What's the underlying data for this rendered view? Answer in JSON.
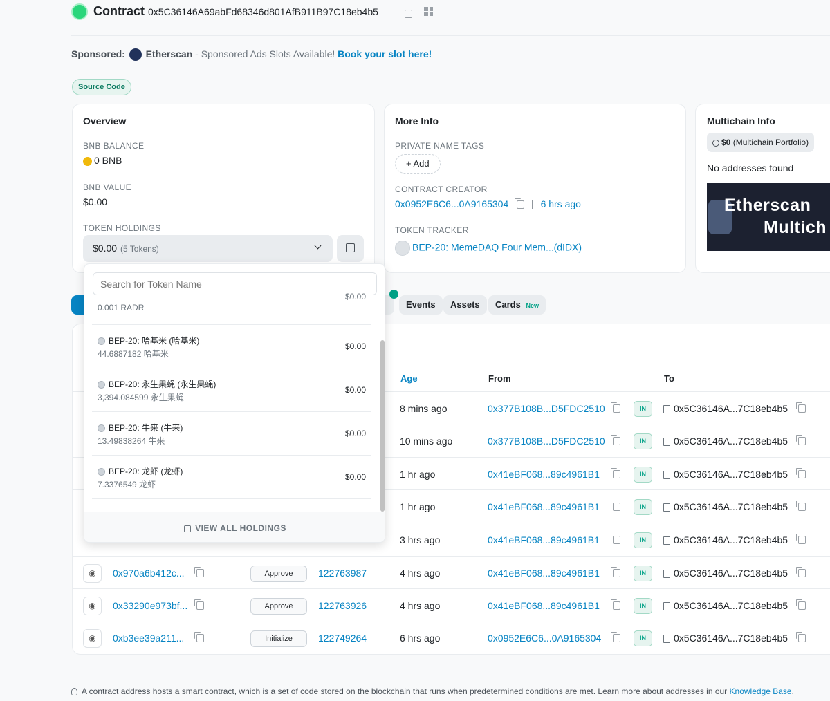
{
  "header": {
    "title": "Contract",
    "address": "0x5C36146A69abFd68346d801AfB911B97C18eb4b5"
  },
  "sponsored": {
    "label": "Sponsored:",
    "brand": "Etherscan",
    "text": " - Sponsored Ads Slots Available! ",
    "cta": "Book your slot here!"
  },
  "source_code_badge": "Source Code",
  "overview": {
    "title": "Overview",
    "bnb_balance_label": "BNB BALANCE",
    "bnb_balance": "0 BNB",
    "bnb_value_label": "BNB VALUE",
    "bnb_value": "$0.00",
    "token_holdings_label": "TOKEN HOLDINGS",
    "token_holdings_value": "$0.00",
    "token_holdings_count": "(5 Tokens)"
  },
  "more_info": {
    "title": "More Info",
    "private_tags_label": "PRIVATE NAME TAGS",
    "add_label": "+ Add",
    "creator_label": "CONTRACT CREATOR",
    "creator_address": "0x0952E6C6...0A9165304",
    "creator_sep": "|",
    "creator_age": "6 hrs ago",
    "tracker_label": "TOKEN TRACKER",
    "tracker_value": "BEP-20: MemeDAQ Four Mem...(dIDX)"
  },
  "multichain": {
    "title": "Multichain Info",
    "portfolio_amount": "$0",
    "portfolio_label": "(Multichain Portfolio)",
    "no_addresses": "No addresses found",
    "banner_line1": "Etherscan",
    "banner_line2": "Multich"
  },
  "tabs": [
    "Events",
    "Assets",
    "Cards"
  ],
  "cards_new_badge": "New",
  "token_dropdown": {
    "search_placeholder": "Search for Token Name",
    "partial_item": {
      "sub": "0.001 RADR",
      "value": "$0.00"
    },
    "items": [
      {
        "name": "BEP-20: 哈基米 (哈基米)",
        "sub": "44.6887182 哈基米",
        "value": "$0.00"
      },
      {
        "name": "BEP-20: 永生果蝇 (永生果蝇)",
        "sub": "3,394.084599 永生果蝇",
        "value": "$0.00"
      },
      {
        "name": "BEP-20: 牛来 (牛来)",
        "sub": "13.49838264 牛来",
        "value": "$0.00"
      },
      {
        "name": "BEP-20: 龙虾 (龙虾)",
        "sub": "7.3376549 龙虾",
        "value": "$0.00"
      }
    ],
    "view_all": "VIEW ALL HOLDINGS"
  },
  "table": {
    "headers": {
      "age": "Age",
      "from": "From",
      "to": "To"
    },
    "rows": [
      {
        "hash": "",
        "method": "",
        "block": "",
        "age": "8 mins ago",
        "from": "0x377B108B...D5FDC2510",
        "dir": "IN",
        "to": "0x5C36146A...7C18eb4b5"
      },
      {
        "hash": "",
        "method": "",
        "block": "",
        "age": "10 mins ago",
        "from": "0x377B108B...D5FDC2510",
        "dir": "IN",
        "to": "0x5C36146A...7C18eb4b5"
      },
      {
        "hash": "",
        "method": "",
        "block": "",
        "age": "1 hr ago",
        "from": "0x41eBF068...89c4961B1",
        "dir": "IN",
        "to": "0x5C36146A...7C18eb4b5"
      },
      {
        "hash": "",
        "method": "",
        "block": "",
        "age": "1 hr ago",
        "from": "0x41eBF068...89c4961B1",
        "dir": "IN",
        "to": "0x5C36146A...7C18eb4b5"
      },
      {
        "hash": "",
        "method": "",
        "block": "",
        "age": "3 hrs ago",
        "from": "0x41eBF068...89c4961B1",
        "dir": "IN",
        "to": "0x5C36146A...7C18eb4b5"
      },
      {
        "hash": "0x970a6b412c...",
        "method": "Approve",
        "block": "122763987",
        "age": "4 hrs ago",
        "from": "0x41eBF068...89c4961B1",
        "dir": "IN",
        "to": "0x5C36146A...7C18eb4b5"
      },
      {
        "hash": "0x33290e973bf...",
        "method": "Approve",
        "block": "122763926",
        "age": "4 hrs ago",
        "from": "0x41eBF068...89c4961B1",
        "dir": "IN",
        "to": "0x5C36146A...7C18eb4b5"
      },
      {
        "hash": "0xb3ee39a211...",
        "method": "Initialize",
        "block": "122749264",
        "age": "6 hrs ago",
        "from": "0x0952E6C6...0A9165304",
        "dir": "IN",
        "to": "0x5C36146A...7C18eb4b5"
      }
    ]
  },
  "footer": {
    "text": "A contract address hosts a smart contract, which is a set of code stored on the blockchain that runs when predetermined conditions are met. Learn more about addresses in our ",
    "link": "Knowledge Base",
    "end": "."
  }
}
